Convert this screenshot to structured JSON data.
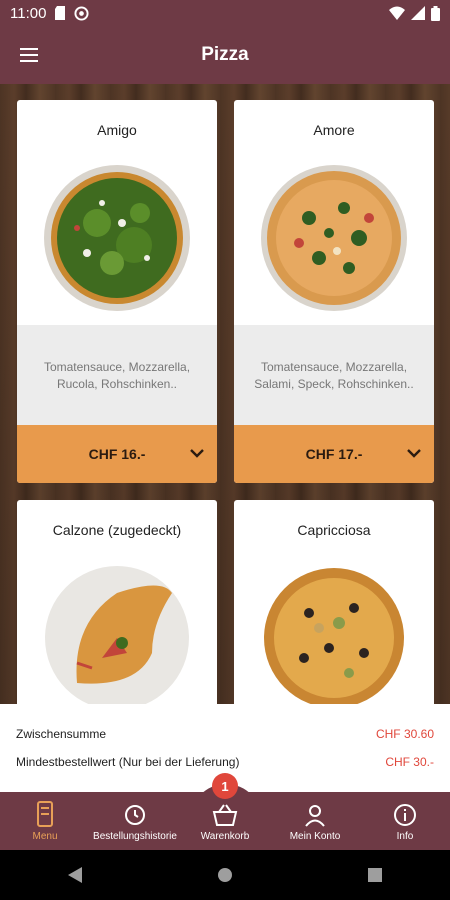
{
  "status": {
    "time": "11:00"
  },
  "header": {
    "title": "Pizza"
  },
  "products": [
    {
      "name": "Amigo",
      "desc": "Tomatensauce, Mozzarella, Rucola, Rohschinken..",
      "price": "CHF 16.-"
    },
    {
      "name": "Amore",
      "desc": "Tomatensauce, Mozzarella, Salami, Speck, Rohschinken..",
      "price": "CHF 17.-"
    },
    {
      "name": "Calzone (zugedeckt)"
    },
    {
      "name": "Capricciosa"
    }
  ],
  "summary": {
    "subtotal_label": "Zwischensumme",
    "subtotal_value": "CHF 30.60",
    "minimum_label": "Mindestbestellwert (Nur bei der Lieferung)",
    "minimum_value": "CHF 30.-"
  },
  "nav": {
    "menu": "Menu",
    "history": "Bestellungshistorie",
    "cart": "Warenkorb",
    "cart_count": "1",
    "account": "Mein Konto",
    "info": "Info"
  },
  "colors": {
    "brand": "#6e3a45",
    "accent": "#e89a4c",
    "price_red": "#e0473b"
  }
}
